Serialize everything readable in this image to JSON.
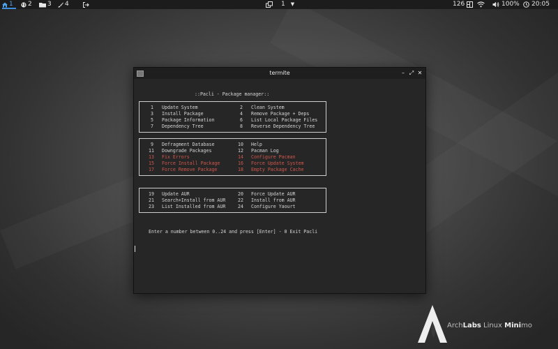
{
  "panel": {
    "workspaces": [
      {
        "num": "1",
        "icon": "home-icon"
      },
      {
        "num": "2",
        "icon": "globe-icon"
      },
      {
        "num": "3",
        "icon": "folder-icon"
      },
      {
        "num": "4",
        "icon": "brush-icon"
      }
    ],
    "center_workspace": "1",
    "brightness": "126",
    "volume": "100%",
    "clock": "20:05"
  },
  "window": {
    "title": "termite",
    "buttons": [
      "–",
      "⤢",
      "✕"
    ]
  },
  "terminal": {
    "heading": "::Pacli - Package manager::",
    "group1": [
      {
        "num": "1",
        "label": "Update System",
        "num2": "2",
        "label2": "Clean System"
      },
      {
        "num": "3",
        "label": "Install Package",
        "num2": "4",
        "label2": "Remove Package + Deps"
      },
      {
        "num": "5",
        "label": "Package Information",
        "num2": "6",
        "label2": "List Local Package Files"
      },
      {
        "num": "7",
        "label": "Dependency Tree",
        "num2": "8",
        "label2": "Reverse Dependency Tree"
      }
    ],
    "group2": [
      {
        "num": "9",
        "label": "Defragment Database",
        "num2": "10",
        "label2": "Help"
      },
      {
        "num": "11",
        "label": "Downgrade Packages",
        "num2": "12",
        "label2": "Pacman Log"
      },
      {
        "num": "13",
        "label": "Fix Errors",
        "num2": "14",
        "label2": "Configure Pacman"
      },
      {
        "num": "15",
        "label": "Force Install Package",
        "num2": "16",
        "label2": "Force Update System"
      },
      {
        "num": "17",
        "label": "Force Remove Package",
        "num2": "18",
        "label2": "Empty Package Cache"
      }
    ],
    "group3": [
      {
        "num": "19",
        "label": "Update AUR",
        "num2": "20",
        "label2": "Force Update AUR"
      },
      {
        "num": "21",
        "label": "Search+Install from AUR",
        "num2": "22",
        "label2": "Install from AUR"
      },
      {
        "num": "23",
        "label": "List Installed from AUR",
        "num2": "24",
        "label2": "Configure Yaourt"
      }
    ],
    "prompt": "Enter a number between 0..24 and press [Enter] - 0 Exit Pacli"
  },
  "branding": {
    "part1": "Arch",
    "part2": "Labs",
    "part3": " Linux ",
    "part4": "Mini",
    "part5": "mo"
  },
  "colors": {
    "accent": "#3d8fdc",
    "warning_text": "#d0584d",
    "terminal_bg": "#262626"
  }
}
